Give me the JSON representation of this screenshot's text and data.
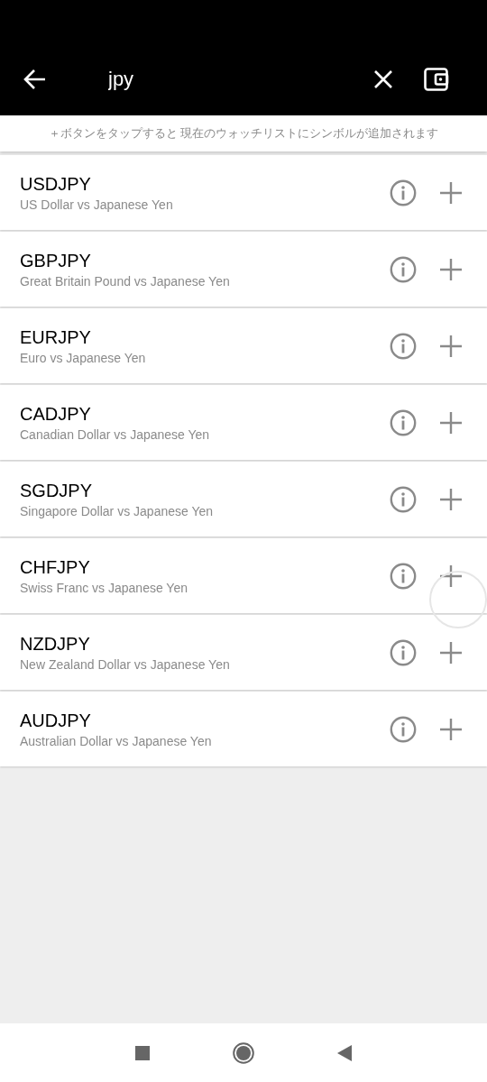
{
  "search": {
    "value": "jpy"
  },
  "hint": "＋ボタンをタップすると 現在のウォッチリストにシンボルが追加されます",
  "symbols": [
    {
      "symbol": "USDJPY",
      "description": "US Dollar vs Japanese Yen",
      "touched": false
    },
    {
      "symbol": "GBPJPY",
      "description": "Great Britain Pound vs Japanese Yen",
      "touched": false
    },
    {
      "symbol": "EURJPY",
      "description": "Euro vs Japanese Yen",
      "touched": false
    },
    {
      "symbol": "CADJPY",
      "description": "Canadian Dollar vs Japanese Yen",
      "touched": false
    },
    {
      "symbol": "SGDJPY",
      "description": "Singapore Dollar vs Japanese Yen",
      "touched": false
    },
    {
      "symbol": "CHFJPY",
      "description": "Swiss Franc vs Japanese Yen",
      "touched": true
    },
    {
      "symbol": "NZDJPY",
      "description": "New Zealand Dollar vs Japanese Yen",
      "touched": false
    },
    {
      "symbol": "AUDJPY",
      "description": "Australian Dollar vs Japanese Yen",
      "touched": false
    }
  ]
}
